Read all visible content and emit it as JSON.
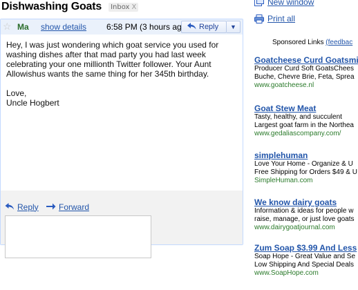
{
  "subject": "Dishwashing Goats",
  "label": {
    "name": "Inbox",
    "remove": "X"
  },
  "message": {
    "star_icon": "☆",
    "sender": "Ma",
    "show_details": "show details",
    "time": "6:58 PM (3 hours ago)",
    "reply_button": "Reply",
    "more_icon": "▼",
    "body_paragraphs": [
      "Hey, I was just wondering which goat service you used for washing dishes after that mad party you had last week celebrating your one millionth Twitter follower. Your Aunt Allowishus wants the same thing for her 345th birthday.",
      "Love,\nUncle Hogbert"
    ],
    "body_line1": "Hey, I was just wondering which goat service you used for",
    "body_line2": "washing dishes after that mad party you had last week",
    "body_line3": "celebrating your one millionth Twitter follower. Your Aunt",
    "body_line4": "Allowishus wants the same thing for her 345th birthday.",
    "closing1": "Love,",
    "closing2": "Uncle Hogbert",
    "reply_link": "Reply",
    "forward_link": "Forward"
  },
  "actions": {
    "new_window": "New window",
    "print_all": "Print all"
  },
  "sponsored": {
    "label": "Sponsored Links",
    "feedback": "(feedbac"
  },
  "ads": [
    {
      "title": "Goatcheese Curd Goatsmilk",
      "line1": "Producer Curd Soft GoatsChees",
      "line2": "Buche, Chevre Brie, Feta, Sprea",
      "url": "www.goatcheese.nl"
    },
    {
      "title": "Goat Stew Meat",
      "line1": "Tasty, healthy, and succulent",
      "line2": "Largest goat farm in the Northea",
      "url": "www.gedaliascompany.com/"
    },
    {
      "title": "simplehuman",
      "line1": "Love Your Home - Organize & U",
      "line2": "Free Shipping for Orders $49 & U",
      "url": "SimpleHuman.com"
    },
    {
      "title": "We know dairy goats",
      "line1": "Information & ideas for people w",
      "line2": "raise, manage, or just love goats",
      "url": "www.dairygoatjournal.com"
    },
    {
      "title": "Zum Soap $3.99 And Less",
      "line1": "Soap Hope - Great Value and Se",
      "line2": "Low Shipping And Special Deals",
      "url": "www.SoapHope.com"
    }
  ],
  "colors": {
    "link": "#2255aa",
    "url_green": "#2a7a2a",
    "header_bg": "#eaf1fb",
    "footer_bg": "#f2f2f2",
    "border": "#c3d9ff"
  }
}
